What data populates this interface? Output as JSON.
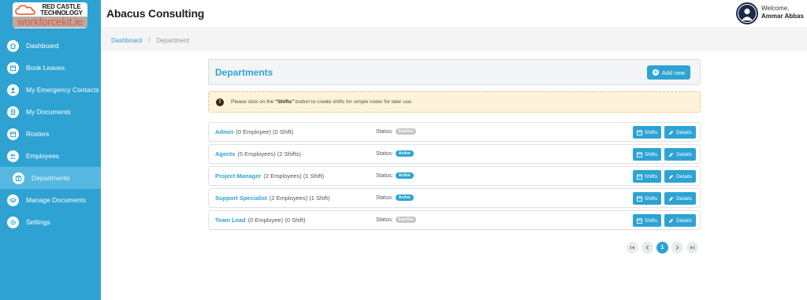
{
  "logo": {
    "line1": "RED CASTLE",
    "line2": "TECHNOLOGY",
    "line3": "workforcekit.ie"
  },
  "header": {
    "company": "Abacus Consulting",
    "welcome": "Welcome,",
    "user": "Ammar Abbas"
  },
  "breadcrumb": {
    "home": "Dashboard",
    "separator": "/",
    "current": "Department"
  },
  "sidebar": {
    "items": [
      {
        "label": "Dashboard",
        "icon": "home-icon"
      },
      {
        "label": "Book Leaves",
        "icon": "calendar-icon"
      },
      {
        "label": "My Emergency Contacts",
        "icon": "user-icon"
      },
      {
        "label": "My Documents",
        "icon": "document-icon"
      },
      {
        "label": "Rosters",
        "icon": "calendar-icon"
      },
      {
        "label": "Employees",
        "icon": "users-icon"
      },
      {
        "label": "Departments",
        "icon": "building-icon",
        "active": true
      },
      {
        "label": "Manage Documents",
        "icon": "layers-icon"
      },
      {
        "label": "Settings",
        "icon": "gear-icon"
      }
    ]
  },
  "panel": {
    "title": "Departments",
    "add_label": "Add new"
  },
  "notice": {
    "before": "Please click on the ",
    "bold": "\"Shifts\"",
    "after": " button to create shifts for simple roster for later use."
  },
  "departments": [
    {
      "name": "Admin",
      "employees": "(0 Employee)",
      "shifts": "(0 Shift)",
      "status_label": "Status:",
      "status": "Inactive"
    },
    {
      "name": "Agents",
      "employees": "(5 Employees)",
      "shifts": "(2 Shifts)",
      "status_label": "Status:",
      "status": "Active"
    },
    {
      "name": "Project Manager",
      "employees": "(2 Employees)",
      "shifts": "(1 Shift)",
      "status_label": "Status:",
      "status": "Active"
    },
    {
      "name": "Support Specialist",
      "employees": "(2 Employees)",
      "shifts": "(1 Shift)",
      "status_label": "Status:",
      "status": "Active"
    },
    {
      "name": "Team Lead",
      "employees": "(0 Employee)",
      "shifts": "(0 Shift)",
      "status_label": "Status:",
      "status": "Inactive"
    }
  ],
  "row_buttons": {
    "shifts": "Shifts",
    "details": "Details"
  },
  "pagination": {
    "current": "1"
  },
  "colors": {
    "primary": "#2ea3d3",
    "sidebar": "#2ea3d3",
    "inactive_badge": "#c6c6c6",
    "notice_bg": "#fdf3dd"
  }
}
